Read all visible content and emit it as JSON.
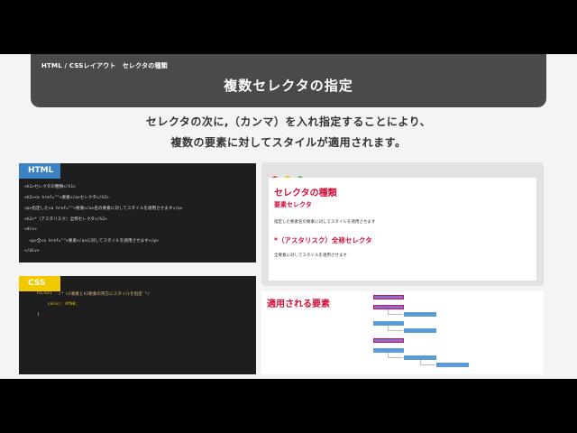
{
  "header": {
    "breadcrumb": "HTML / CSSレイアウト　セレクタの種類",
    "title": "複数セレクタの指定"
  },
  "description": {
    "line1": "セレクタの次に,（カンマ）を入れ指定することにより、",
    "line2": "複数の要素に対してスタイルが適用されます。"
  },
  "html_panel": {
    "label": "HTML",
    "lines": [
      "<h1>セレクタの種類</h1>",
      "<h2><a href=\"\">要素</a>セレクタ</h2>",
      "<p>指定した<a href=\"\">要素</a>名の要素に対してスタイルを適用させます</p>",
      "<h2>*（アスタリスク）全称セレクタ</h2>",
      "<div>",
      "  <p>全<a href=\"\">要素</a>に対してスタイルを適用させます</p>",
      "</div>"
    ]
  },
  "css_panel": {
    "label": "CSS",
    "selector": "h1,h2{",
    "comment": "/* h1要素とh2要素の両方にスタイルを指定 */",
    "property": "color: #f00;",
    "close": "}"
  },
  "browser": {
    "dot_colors": [
      "#ef5350",
      "#f2c900",
      "#5cb85c"
    ],
    "h1": "セレクタの種類",
    "h2a": "要素セレクタ",
    "p1": "指定した要素名の要素に対してスタイルを適用させます",
    "h2b": "*（アスタリスク）全称セレクタ",
    "p2": "全要素に対してスタイルを適用させます"
  },
  "applied": {
    "label": "適用される要素"
  },
  "colors": {
    "accent": "#d0103a",
    "html_tag": "#3b82c4",
    "css_tag": "#f2c900",
    "header_bg": "#4a4a4a"
  }
}
